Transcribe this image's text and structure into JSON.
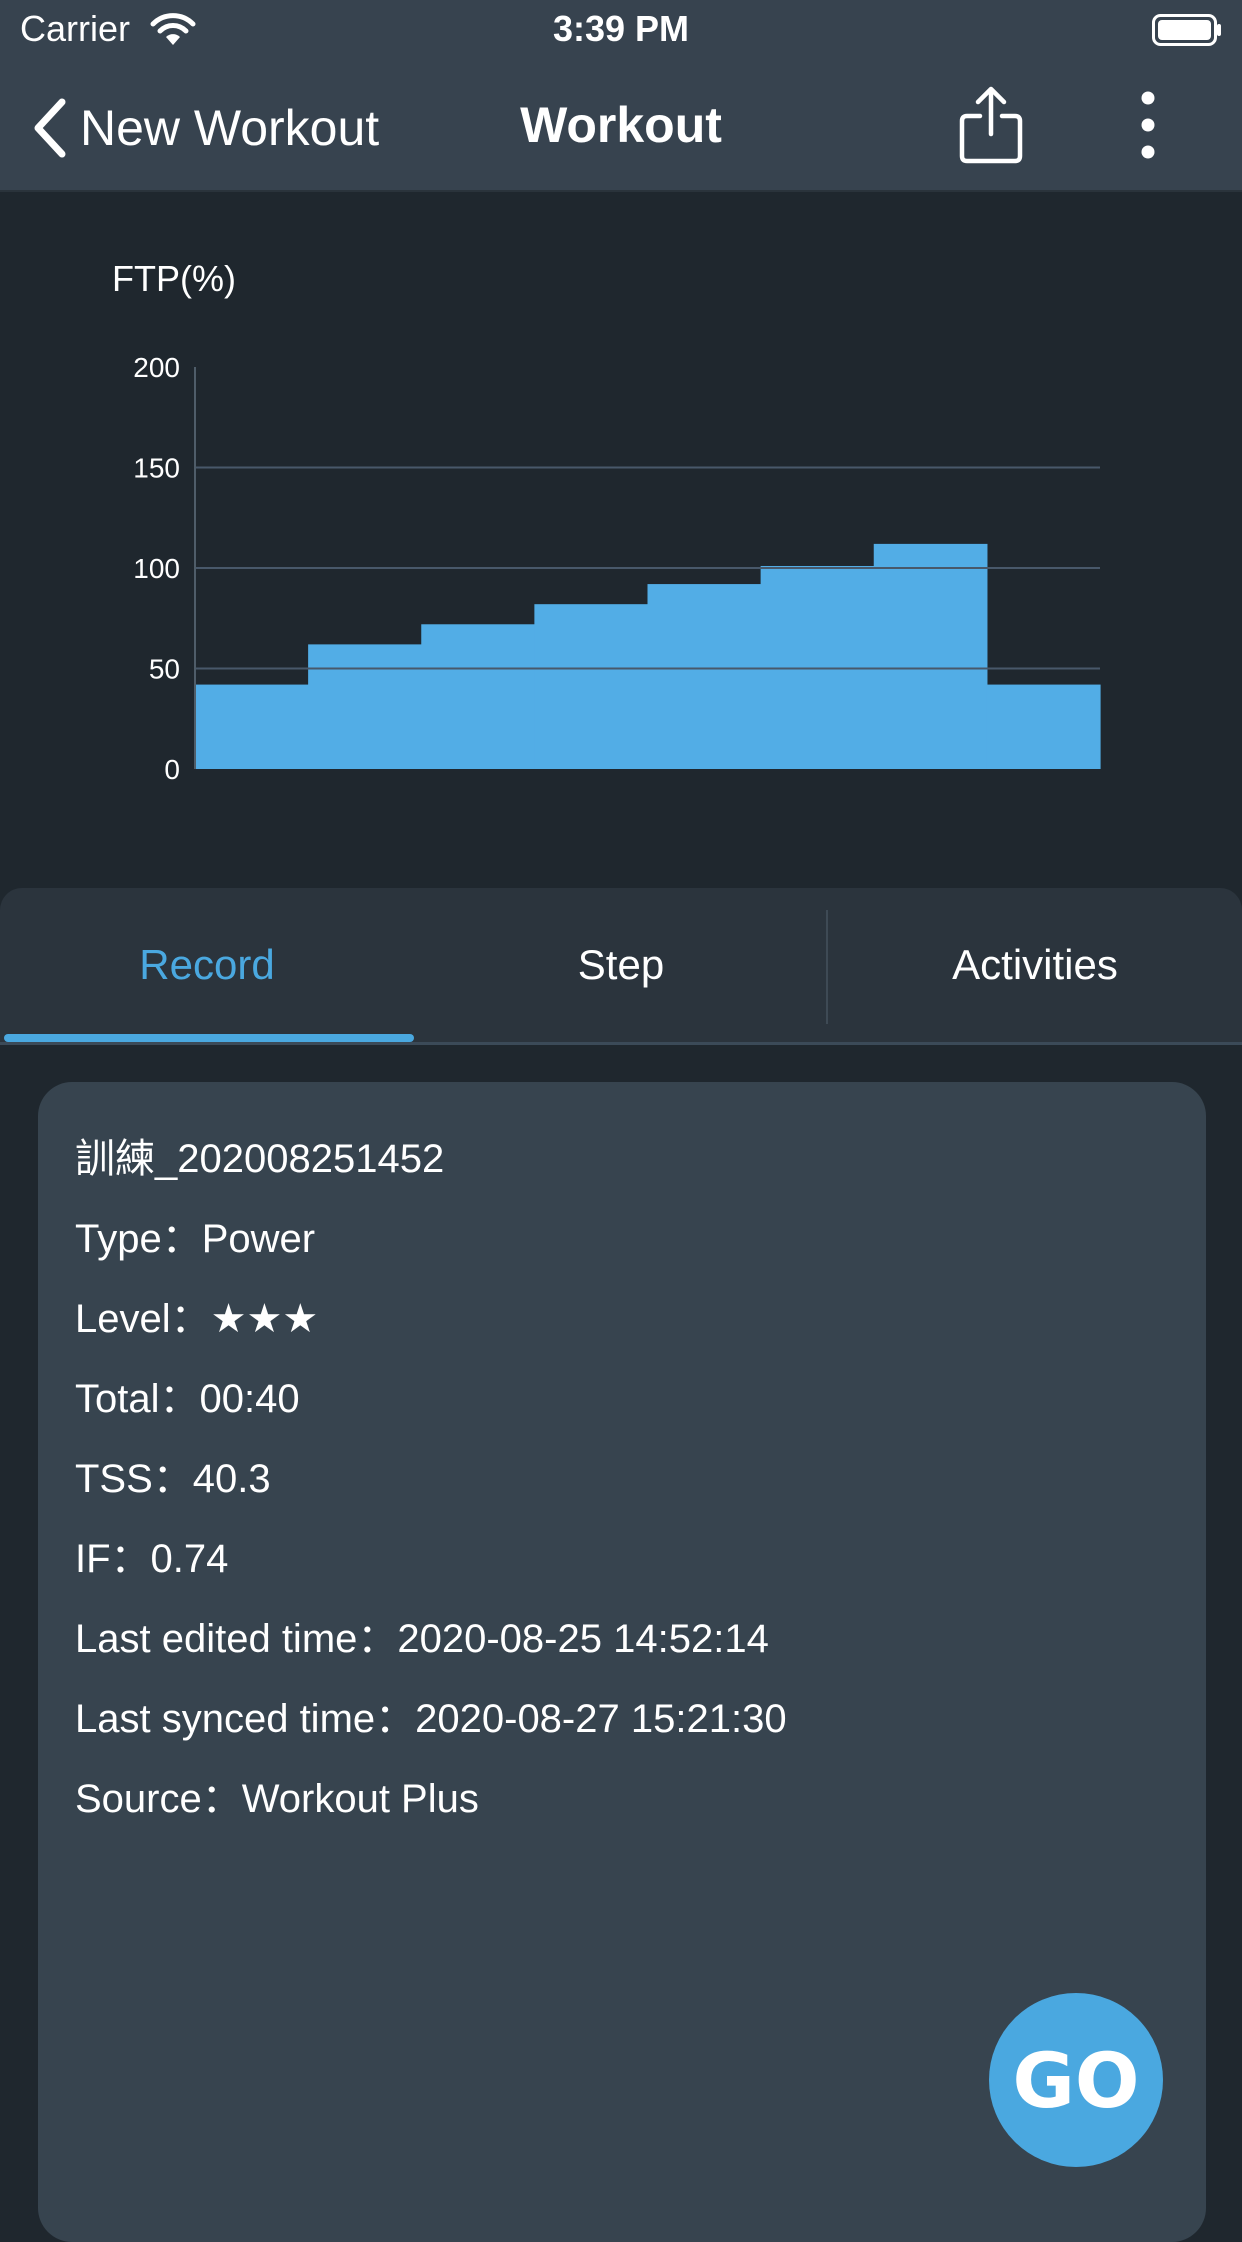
{
  "status_bar": {
    "carrier": "Carrier",
    "time": "3:39 PM"
  },
  "nav": {
    "back_label": "New Workout",
    "title": "Workout"
  },
  "chart_data": {
    "type": "bar",
    "ylabel": "FTP(%)",
    "yticks": [
      0,
      50,
      100,
      150,
      200
    ],
    "ylim": [
      0,
      200
    ],
    "grid": true,
    "color": "#52ade6",
    "values": [
      42,
      62,
      72,
      82,
      92,
      101,
      112,
      42
    ]
  },
  "tabs": [
    {
      "label": "Record",
      "active": true
    },
    {
      "label": "Step",
      "active": false
    },
    {
      "label": "Activities",
      "active": false
    }
  ],
  "record": {
    "name": "訓練_202008251452",
    "type": "Type：Power",
    "level": "Level：★★★",
    "total": "Total：00:40",
    "tss": "TSS：40.3",
    "if": "IF：0.74",
    "last_edited": "Last edited time：2020-08-25 14:52:14",
    "last_synced": "Last synced time：2020-08-27 15:21:30",
    "source": "Source：Workout Plus"
  },
  "go_label": "GO",
  "colors": {
    "accent": "#4aa8e0",
    "nav_bg": "#37434f",
    "card_bg": "#37444f",
    "page_bg": "#1f272e"
  }
}
